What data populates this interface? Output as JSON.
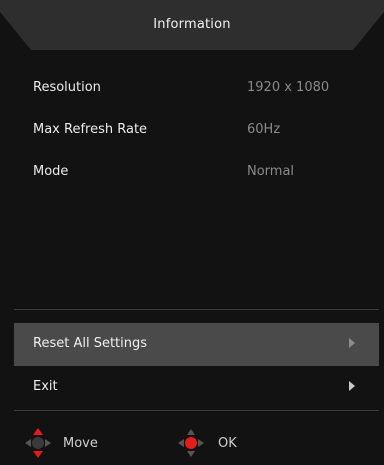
{
  "header": {
    "title": "Information"
  },
  "info": [
    {
      "label": "Resolution",
      "value": "1920 x 1080"
    },
    {
      "label": "Max Refresh Rate",
      "value": "60Hz"
    },
    {
      "label": "Mode",
      "value": "Normal"
    }
  ],
  "menu": [
    {
      "label": "Reset All Settings",
      "selected": true,
      "icon": "chevron-right-icon"
    },
    {
      "label": "Exit",
      "selected": false,
      "icon": "chevron-right-icon"
    }
  ],
  "footer": {
    "move": {
      "label": "Move",
      "icon": "dpad-vertical-icon"
    },
    "ok": {
      "label": "OK",
      "icon": "dpad-center-icon"
    }
  },
  "colors": {
    "accent": "#e41c1c",
    "background": "#121212",
    "selected_row": "#4a4a4a"
  }
}
